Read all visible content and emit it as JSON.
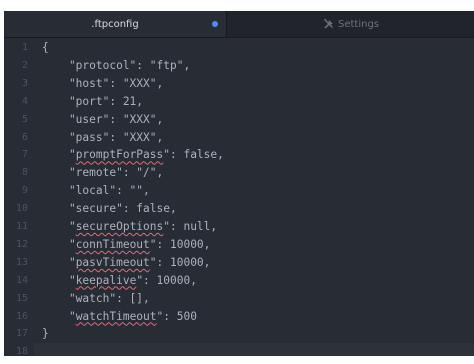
{
  "tabs": [
    {
      "label": ".ftpconfig",
      "modified": true
    },
    {
      "label": "Settings",
      "icon": "settings-tools-icon"
    }
  ],
  "editor": {
    "line_numbers": [
      "1",
      "2",
      "3",
      "4",
      "5",
      "6",
      "7",
      "8",
      "9",
      "10",
      "11",
      "12",
      "13",
      "14",
      "15",
      "16",
      "17",
      "18"
    ],
    "lines": [
      "{",
      "    \"protocol\": \"ftp\",",
      "    \"host\": \"XXX\",",
      "    \"port\": 21,",
      "    \"user\": \"XXX\",",
      "    \"pass\": \"XXX\",",
      "    \"promptForPass\": false,",
      "    \"remote\": \"/\",",
      "    \"local\": \"\",",
      "    \"secure\": false,",
      "    \"secureOptions\": null,",
      "    \"connTimeout\": 10000,",
      "    \"pasvTimeout\": 10000,",
      "    \"keepalive\": 10000,",
      "    \"watch\": [],",
      "    \"watchTimeout\": 500",
      "}",
      ""
    ],
    "spellcheck_flagged": [
      "promptForPass",
      "secureOptions",
      "connTimeout",
      "pasvTimeout",
      "keepalive",
      "watchTimeout"
    ]
  },
  "colors": {
    "editor_bg": "#282c34",
    "tabbar_bg": "#21252b",
    "text": "#abb2bf",
    "gutter_text": "#4b5263",
    "modified_dot": "#568af2",
    "spell_underline": "#e06c75"
  }
}
